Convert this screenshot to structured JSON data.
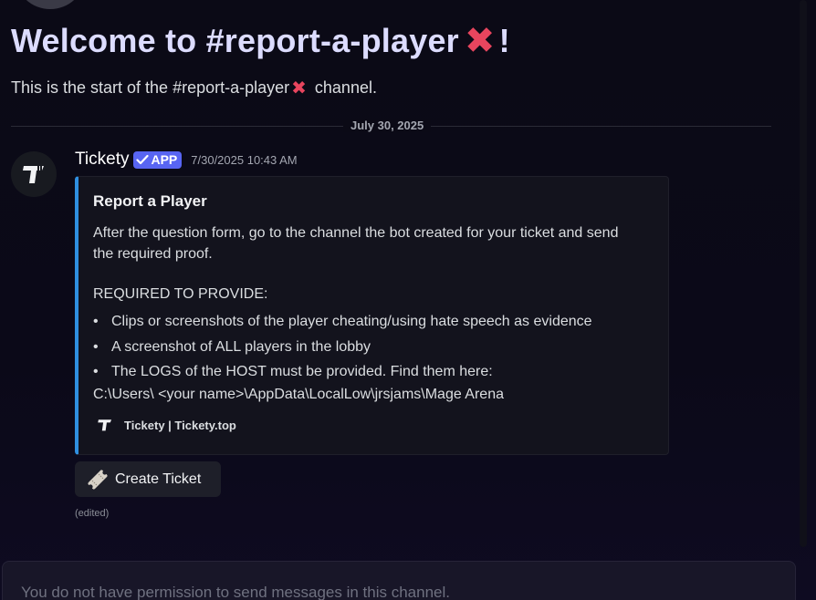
{
  "welcome": {
    "title_prefix": "Welcome to #report-a-player",
    "title_suffix": "!",
    "title_emoji": "✖",
    "subtitle_prefix": "This is the start of the #report-a-player",
    "subtitle_emoji": "✖",
    "subtitle_suffix": " channel."
  },
  "divider": {
    "date": "July 30, 2025"
  },
  "message": {
    "username": "Tickety",
    "badge": "APP",
    "timestamp": "7/30/2025 10:43 AM",
    "avatar_icon": "tickety-logo-icon",
    "embed": {
      "title": "Report a Player",
      "description": "After the question form, go to the channel the bot created for your ticket and send the required proof.",
      "required_heading": "REQUIRED TO PROVIDE:",
      "items": [
        "Clips or screenshots of the player cheating/using hate speech as evidence",
        "A screenshot of ALL players in the lobby",
        "The LOGS of the HOST must be provided. Find them here:"
      ],
      "path": "C:\\Users\\ <your name>\\AppData\\LocalLow\\jrsjams\\Mage Arena",
      "footer": "Tickety | Tickety.top",
      "accent_color": "#2f8fe0"
    },
    "button": {
      "icon": "ticket-icon",
      "label": "Create Ticket"
    },
    "edited": "(edited)"
  },
  "input": {
    "placeholder": "You do not have permission to send messages in this channel."
  },
  "colors": {
    "title": "#dcdcff",
    "emoji_red": "#e8455e",
    "badge": "#5865f2",
    "background": "#0b0a16"
  }
}
